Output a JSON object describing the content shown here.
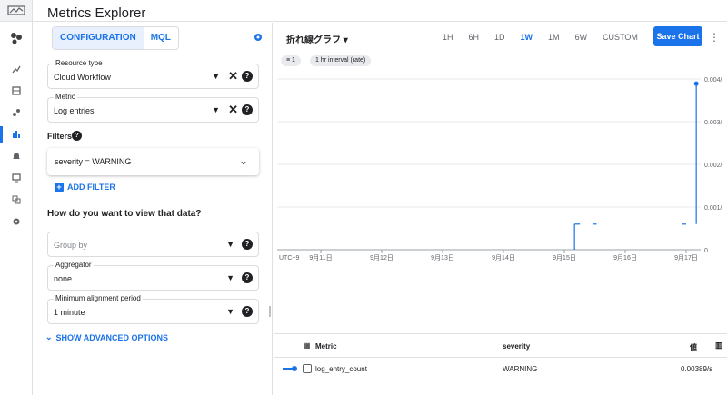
{
  "app": {
    "title": "Metrics Explorer"
  },
  "rail": {
    "items": [
      "monitoring-logo-icon",
      "dashboard-overview-icon",
      "trend-chart-icon",
      "dashboards-icon",
      "services-icon",
      "metrics-explorer-icon",
      "alerting-icon",
      "uptime-icon",
      "groups-icon",
      "settings-icon"
    ]
  },
  "config": {
    "tabs": [
      {
        "label": "CONFIGURATION"
      },
      {
        "label": "MQL"
      }
    ],
    "resource_type": {
      "label": "Resource type",
      "value": "Cloud Workflow"
    },
    "metric": {
      "label": "Metric",
      "value": "Log entries"
    },
    "filters_label": "Filters",
    "filter_value": "severity = WARNING",
    "add_filter": "ADD FILTER",
    "view_question": "How do you want to view that data?",
    "group_by": {
      "placeholder": "Group by"
    },
    "aggregator": {
      "label": "Aggregator",
      "value": "none"
    },
    "alignment": {
      "label": "Minimum alignment period",
      "value": "1 minute"
    },
    "show_advanced": "SHOW ADVANCED OPTIONS"
  },
  "toolbar": {
    "chart_type": "折れ線グラフ",
    "ranges": [
      "1H",
      "6H",
      "1D",
      "1W",
      "1M",
      "6W",
      "CUSTOM"
    ],
    "active_range": "1W",
    "save_label": "Save Chart"
  },
  "chips": {
    "filter_count": "1",
    "interval": "1 hr interval (rate)"
  },
  "chart_data": {
    "type": "line",
    "x_tick_labels": [
      "UTC+9",
      "9月11日",
      "9月12日",
      "9月13日",
      "9月14日",
      "9月15日",
      "9月16日",
      "9月17日"
    ],
    "y_tick_labels": [
      "0",
      "0.001/",
      "0.002/",
      "0.003/",
      "0.004/"
    ],
    "ylim": [
      0,
      0.004
    ],
    "series": [
      {
        "name": "log_entry_count",
        "points": [
          {
            "x": "9月15日 04:00",
            "y": 0.0006
          },
          {
            "x": "9月15日 12:00",
            "y": 0.0006
          },
          {
            "x": "9月17日 00:00",
            "y": 0.0006
          },
          {
            "x": "9月17日 04:00",
            "y": 0.00389
          }
        ]
      }
    ],
    "color": "#1a73e8"
  },
  "legend": {
    "col_metric": "Metric",
    "col_severity": "severity",
    "col_value": "値",
    "row": {
      "metric": "log_entry_count",
      "severity": "WARNING",
      "value": "0.00389/s"
    }
  }
}
